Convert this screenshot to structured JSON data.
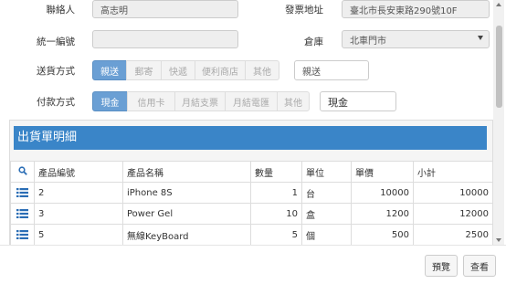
{
  "form": {
    "contact_label": "聯絡人",
    "contact_value": "高志明",
    "invoice_address_label": "發票地址",
    "invoice_address_value": "臺北市長安東路290號10F",
    "tax_id_label": "統一編號",
    "tax_id_value": "",
    "warehouse_label": "倉庫",
    "warehouse_value": "北車門市",
    "shipping_label": "送貨方式",
    "shipping_options": [
      "親送",
      "郵寄",
      "快遞",
      "便利商店",
      "其他"
    ],
    "shipping_selected": "親送",
    "shipping_value": "親送",
    "payment_label": "付款方式",
    "payment_options": [
      "現金",
      "信用卡",
      "月結支票",
      "月結電匯",
      "其他"
    ],
    "payment_selected": "現金",
    "payment_value": "現金"
  },
  "shipment": {
    "title": "出貨單明細",
    "columns": [
      "",
      "產品編號",
      "產品名稱",
      "數量",
      "單位",
      "單價",
      "小計"
    ],
    "rows": [
      {
        "code": "2",
        "name": "iPhone 8S",
        "qty": "1",
        "unit": "台",
        "price": "10000",
        "subtotal": "10000"
      },
      {
        "code": "3",
        "name": "Power Gel",
        "qty": "10",
        "unit": "盒",
        "price": "1200",
        "subtotal": "12000"
      },
      {
        "code": "5",
        "name": "無線KeyBoard",
        "qty": "5",
        "unit": "個",
        "price": "500",
        "subtotal": "2500"
      }
    ]
  },
  "footer": {
    "preview_label": "預覽",
    "view_label": "查看"
  },
  "colors": {
    "accent": "#3a85c8",
    "active_segment": "#6a9fd4"
  },
  "icons": {
    "search": "search-icon",
    "row": "list-icon"
  }
}
